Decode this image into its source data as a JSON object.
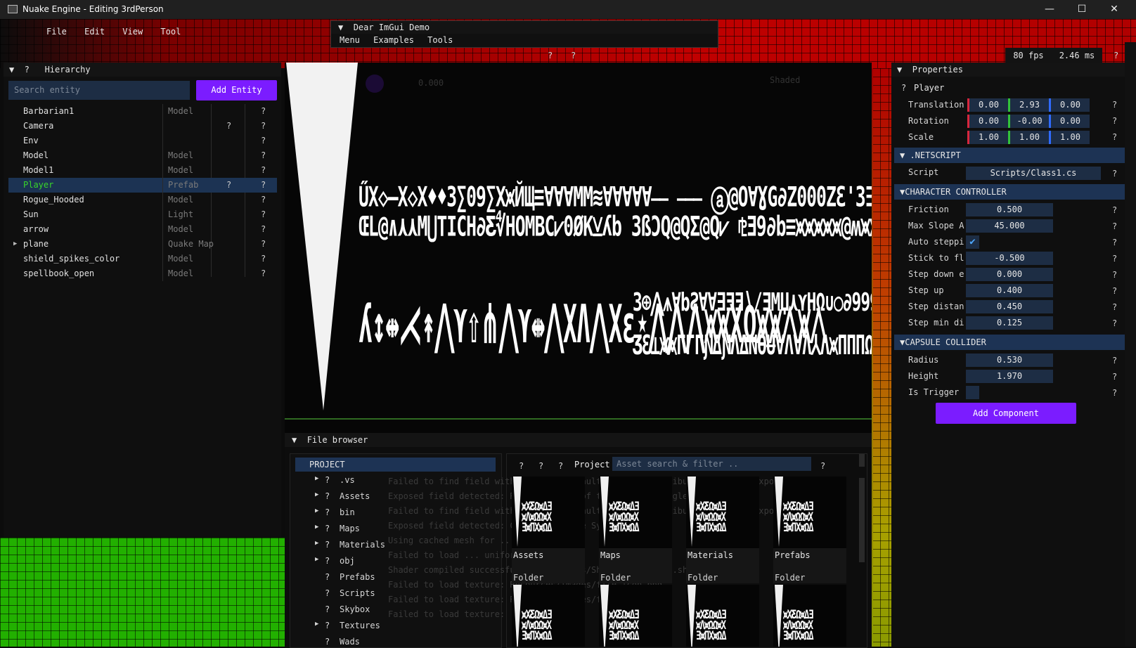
{
  "window": {
    "title": "Nuake Engine - Editing 3rdPerson",
    "minimize": "—",
    "maximize": "☐",
    "close": "✕"
  },
  "menu": [
    "File",
    "Edit",
    "View",
    "Tool"
  ],
  "imgui_demo": {
    "title": "Dear ImGui Demo",
    "menu": [
      "Menu",
      "Examples",
      "Tools"
    ]
  },
  "topbar": {
    "q1": "?",
    "q2": "?",
    "fps": "80 fps",
    "ms": "2.46 ms",
    "q3": "?"
  },
  "hierarchy": {
    "title": "Hierarchy",
    "search_placeholder": "Search entity",
    "add_button": "Add Entity",
    "entities": [
      {
        "name": "Barbarian1",
        "type": "Model",
        "q1": "",
        "q2": "?"
      },
      {
        "name": "Camera",
        "type": "",
        "q1": "?",
        "q2": "?"
      },
      {
        "name": "Env",
        "type": "",
        "q1": "",
        "q2": "?"
      },
      {
        "name": "Model",
        "type": "Model",
        "q1": "",
        "q2": "?"
      },
      {
        "name": "Model1",
        "type": "Model",
        "q1": "",
        "q2": "?"
      },
      {
        "name": "Player",
        "type": "Prefab",
        "q1": "?",
        "q2": "?"
      },
      {
        "name": "Rogue_Hooded",
        "type": "Model",
        "q1": "",
        "q2": "?"
      },
      {
        "name": "Sun",
        "type": "Light",
        "q1": "",
        "q2": "?"
      },
      {
        "name": "arrow",
        "type": "Model",
        "q1": "",
        "q2": "?"
      },
      {
        "name": "plane",
        "type": "Quake Map",
        "q1": "",
        "q2": "?"
      },
      {
        "name": "shield_spikes_color",
        "type": "Model",
        "q1": "",
        "q2": "?"
      },
      {
        "name": "spellbook_open",
        "type": "Model",
        "q1": "",
        "q2": "?"
      }
    ]
  },
  "viewport": {
    "value": "0.000",
    "shading": "Shaded"
  },
  "properties": {
    "title": "Properties",
    "entity": "Player",
    "transform": {
      "translation": {
        "label": "Translation",
        "x": "0.00",
        "y": "2.93",
        "z": "0.00"
      },
      "rotation": {
        "label": "Rotation",
        "x": "0.00",
        "y": "-0.00",
        "z": "0.00"
      },
      "scale": {
        "label": "Scale",
        "x": "1.00",
        "y": "1.00",
        "z": "1.00"
      }
    },
    "netscript": {
      "title": ".NETSCRIPT",
      "script_label": "Script",
      "script_value": "Scripts/Class1.cs"
    },
    "character_controller": {
      "title": "CHARACTER CONTROLLER",
      "rows": [
        {
          "label": "Friction",
          "value": "0.500"
        },
        {
          "label": "Max Slope A",
          "value": "45.000"
        },
        {
          "label": "Auto steppi",
          "value": ""
        },
        {
          "label": "Stick to fl",
          "value": "-0.500"
        },
        {
          "label": "Step down e",
          "value": "0.000"
        },
        {
          "label": "Step up",
          "value": "0.400"
        },
        {
          "label": "Step distan",
          "value": "0.450"
        },
        {
          "label": "Step min di",
          "value": "0.125"
        }
      ]
    },
    "capsule_collider": {
      "title": "CAPSULE COLLIDER",
      "rows": [
        {
          "label": "Radius",
          "value": "0.530"
        },
        {
          "label": "Height",
          "value": "1.970"
        },
        {
          "label": "Is Trigger",
          "value": ""
        }
      ]
    },
    "add_component": "Add Component"
  },
  "file_browser": {
    "title": "File browser",
    "root": "PROJECT",
    "tree": [
      {
        "name": ".vs",
        "expandable": true
      },
      {
        "name": "Assets",
        "expandable": true
      },
      {
        "name": "bin",
        "expandable": true
      },
      {
        "name": "Maps",
        "expandable": true
      },
      {
        "name": "Materials",
        "expandable": true
      },
      {
        "name": "obj",
        "expandable": true
      },
      {
        "name": "Prefabs",
        "expandable": false
      },
      {
        "name": "Scripts",
        "expandable": false
      },
      {
        "name": "Skybox",
        "expandable": false
      },
      {
        "name": "Textures",
        "expandable": true
      },
      {
        "name": "Wads",
        "expandable": false
      }
    ],
    "breadcrumb": "Project",
    "search_placeholder": "Asset search & filter ..",
    "tiles": [
      {
        "name": "Assets",
        "kind": "Folder"
      },
      {
        "name": "Maps",
        "kind": "Folder"
      },
      {
        "name": "Materials",
        "kind": "Folder"
      },
      {
        "name": "Prefabs",
        "kind": "Folder"
      }
    ]
  },
  "log_lines": [
    "Failed to find field with name 'HasDefaultValue' in attribute Nuake.Net.ExposedAttribute",
    "Exposed field detected: RotationSpeed of type System.Single",
    "Failed to find field with name 'HasDefaultValue' in attribute Nuake.Net.ExposedAttribute",
    "Exposed field detected: Counter of type System.Single",
    "Using cached mesh for ...",
    "Failed to load ... uniform not found",
    "Shader compiled successfully: Resources/Shaders/deferred.shader",
    "Failed to load texture: Resources/Images/file_icon.png",
    "Failed to load texture: Resources/Images/folder_icon.png",
    "Failed to load texture: ..."
  ],
  "colors": {
    "accent_purple": "#7b1cff",
    "selection_blue": "#1c3353",
    "input_bg": "#1d2d44",
    "selected_text_green": "#39d62a"
  }
}
